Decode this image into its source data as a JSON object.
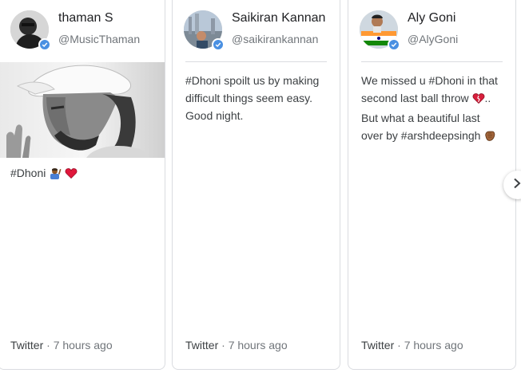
{
  "cards": [
    {
      "name": "thaman S",
      "handle": "@MusicThaman",
      "text": "#Dhoni",
      "source": "Twitter",
      "separator": "·",
      "time": "7 hours ago"
    },
    {
      "name": "Saikiran Kannan",
      "handle": "@saikirankannan",
      "text": "#Dhoni spoilt us by making difficult things seem easy. Good night.",
      "source": "Twitter",
      "separator": "·",
      "time": "7 hours ago"
    },
    {
      "name": "Aly Goni",
      "handle": "@AlyGoni",
      "text_part1": "We missed u #Dhoni in that second last ball throw",
      "text_part2": ".. But what a beautiful last over by #arshdeepsingh",
      "source": "Twitter",
      "separator": "·",
      "time": "7 hours ago"
    }
  ],
  "icons": {
    "verified": "verified-badge-icon",
    "next": "chevron-right-icon",
    "heart": "red-heart-emoji",
    "broken_heart": "broken-heart-emoji",
    "clap": "clapping-hands-emoji",
    "praying": "person-raising-hand-emoji"
  },
  "colors": {
    "verified": "#4a90e2",
    "heart": "#d32f2f",
    "border": "#dadce0",
    "secondary_text": "#70757a"
  }
}
